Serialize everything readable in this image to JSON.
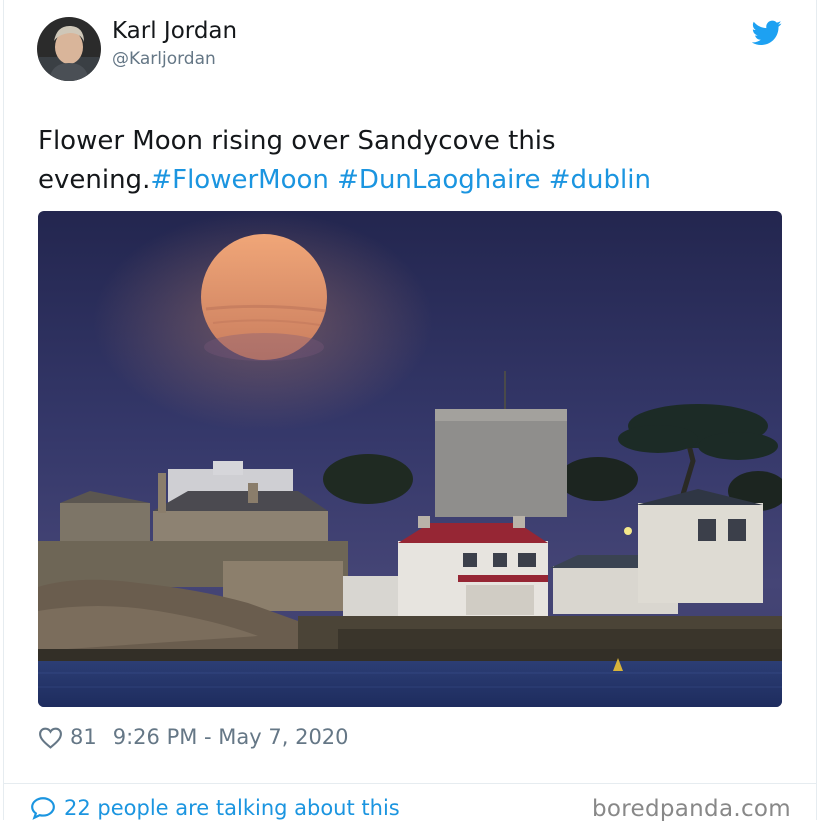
{
  "tweet": {
    "author_name": "Karl Jordan",
    "author_handle": "@Karljordan",
    "text_plain": "Flower Moon rising over Sandycove this evening.",
    "hashtags": [
      "#FlowerMoon",
      "#DunLaoghaire",
      "#dublin"
    ],
    "likes": "81",
    "timestamp": "9:26 PM - May 7, 2020",
    "talking_text": "22 people are talking about this"
  },
  "icons": {
    "brand": "twitter-bird-icon",
    "like": "heart-icon",
    "reply": "speech-bubble-icon"
  },
  "colors": {
    "link": "#1b95e0",
    "muted": "#657786",
    "text": "#14171a",
    "twitter_blue": "#1da1f2"
  },
  "watermark": "boredpanda.com"
}
